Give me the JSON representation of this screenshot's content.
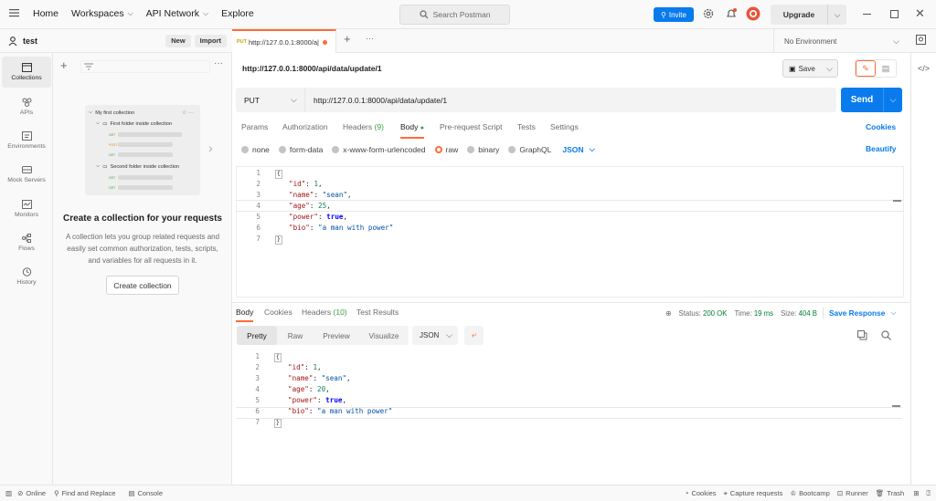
{
  "topbar": {
    "nav": [
      "Home",
      "Workspaces",
      "API Network",
      "Explore"
    ],
    "search_placeholder": "Search Postman",
    "invite": "Invite",
    "upgrade": "Upgrade"
  },
  "rail": {
    "items": [
      "Collections",
      "APIs",
      "Environments",
      "Mock Servers",
      "Monitors",
      "Flows",
      "History"
    ]
  },
  "sidebar": {
    "workspace": "test",
    "new": "New",
    "import": "Import",
    "preview": {
      "collection": "My first collection",
      "folder1": "First folder inside collection",
      "folder2": "Second folder inside collection",
      "methods": [
        "GET",
        "POST",
        "GET",
        "GET",
        "GET"
      ]
    },
    "empty_title": "Create a collection for your requests",
    "empty_desc": "A collection lets you group related requests and easily set common authorization, tests, scripts, and variables for all requests in it.",
    "create_btn": "Create collection"
  },
  "tab": {
    "method": "PUT",
    "title": "http://127.0.0.1:8000/a|",
    "environment": "No Environment"
  },
  "request": {
    "name": "http://127.0.0.1:8000/api/data/update/1",
    "save": "Save",
    "method": "PUT",
    "url": "http://127.0.0.1:8000/api/data/update/1",
    "send": "Send",
    "tabs": [
      "Params",
      "Authorization",
      "Headers",
      "Body",
      "Pre-request Script",
      "Tests",
      "Settings"
    ],
    "headers_count": "(9)",
    "cookies": "Cookies",
    "body_types": [
      "none",
      "form-data",
      "x-www-form-urlencoded",
      "raw",
      "binary",
      "GraphQL"
    ],
    "format": "JSON",
    "beautify": "Beautify",
    "body_lines": [
      [
        "1",
        "{"
      ],
      [
        "2",
        "\"id\": 1,"
      ],
      [
        "3",
        "\"name\": \"sean\","
      ],
      [
        "4",
        "\"age\": 25,"
      ],
      [
        "5",
        "\"power\": true,"
      ],
      [
        "6",
        "\"bio\": \"a man with power\""
      ],
      [
        "7",
        "}"
      ]
    ]
  },
  "response": {
    "tabs": [
      "Body",
      "Cookies",
      "Headers",
      "Test Results"
    ],
    "headers_count": "(10)",
    "status_label": "Status:",
    "status": "200 OK",
    "time_label": "Time:",
    "time": "19 ms",
    "size_label": "Size:",
    "size": "404 B",
    "save_response": "Save Response",
    "views": [
      "Pretty",
      "Raw",
      "Preview",
      "Visualize"
    ],
    "format": "JSON",
    "body_lines": [
      [
        "1",
        "{"
      ],
      [
        "2",
        "\"id\": 1,"
      ],
      [
        "3",
        "\"name\": \"sean\","
      ],
      [
        "4",
        "\"age\": 20,"
      ],
      [
        "5",
        "\"power\": true,"
      ],
      [
        "6",
        "\"bio\": \"a man with power\""
      ],
      [
        "7",
        "}"
      ]
    ]
  },
  "statusbar": {
    "online": "Online",
    "find_replace": "Find and Replace",
    "console": "Console",
    "cookies": "Cookies",
    "capture": "Capture requests",
    "bootcamp": "Bootcamp",
    "runner": "Runner",
    "trash": "Trash"
  },
  "colors": {
    "accent": "#ff6c37",
    "primary": "#097bed",
    "status_ok": "#007f31"
  }
}
